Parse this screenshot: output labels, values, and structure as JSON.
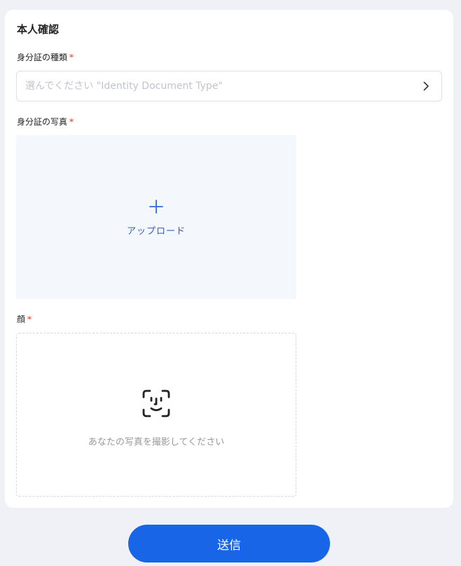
{
  "form": {
    "title": "本人確認",
    "doc_type": {
      "label": "身分証の種類",
      "required_mark": "*",
      "placeholder": "選んでください \"Identity Document Type\""
    },
    "doc_photo": {
      "label": "身分証の写真",
      "required_mark": "*",
      "upload_label": "アップロード"
    },
    "face": {
      "label": "顔",
      "required_mark": "*",
      "hint": "あなたの写真を撮影してください"
    }
  },
  "footer": {
    "submit_label": "送信"
  },
  "icons": {
    "select_chevron": "chevron-right-icon",
    "upload": "plus-icon",
    "face_capture": "face-scan-icon"
  },
  "colors": {
    "primary": "#1865e8",
    "required": "#e8332c",
    "upload_text": "#2d5fbf"
  }
}
